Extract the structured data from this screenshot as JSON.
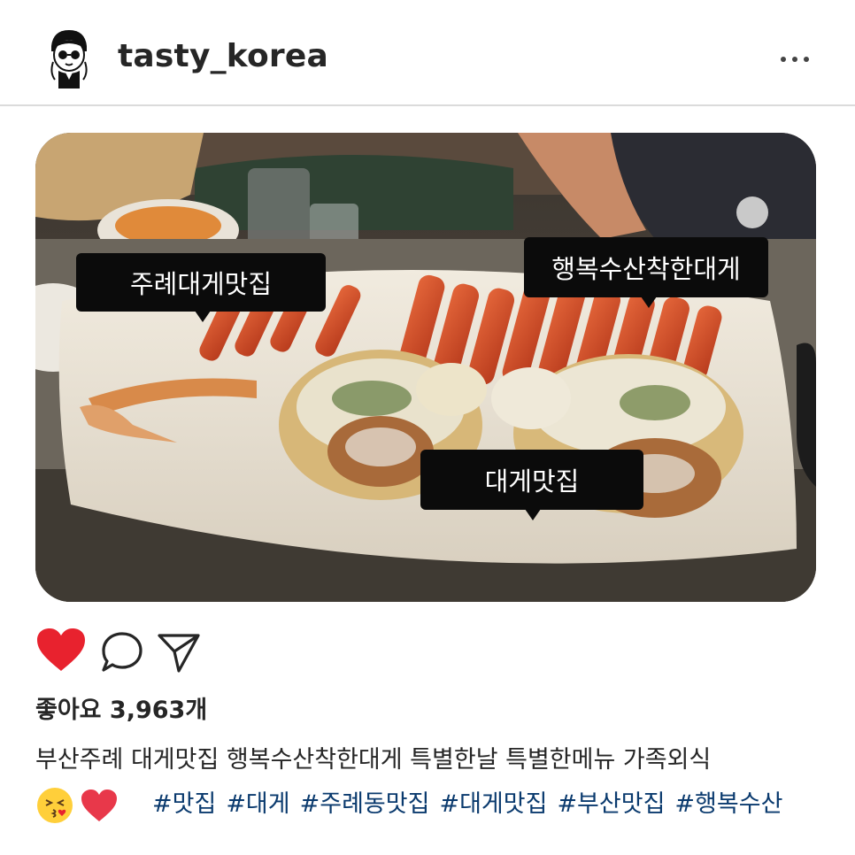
{
  "post": {
    "username": "tasty_korea",
    "photo_tags": [
      "주례대게맛집",
      "행복수산착한대게",
      "대게맛집"
    ],
    "likes_label": "좋아요 3,963개",
    "caption": "부산주례 대게맛집 행복수산착한대게 특별한날 특별한메뉴 가족외식",
    "emojis": [
      "face-blowing-kiss",
      "red-heart"
    ],
    "hashtags": [
      "#맛집",
      "#대게",
      "#주례동맛집",
      "#대게맛집",
      "#부산맛집",
      "#행복수산"
    ]
  },
  "colors": {
    "like_red": "#e8222e",
    "hashtag_blue": "#0a3a6e",
    "divider": "#dbdbdb"
  },
  "icons": [
    "more-options-icon",
    "heart-icon",
    "comment-icon",
    "share-icon"
  ]
}
